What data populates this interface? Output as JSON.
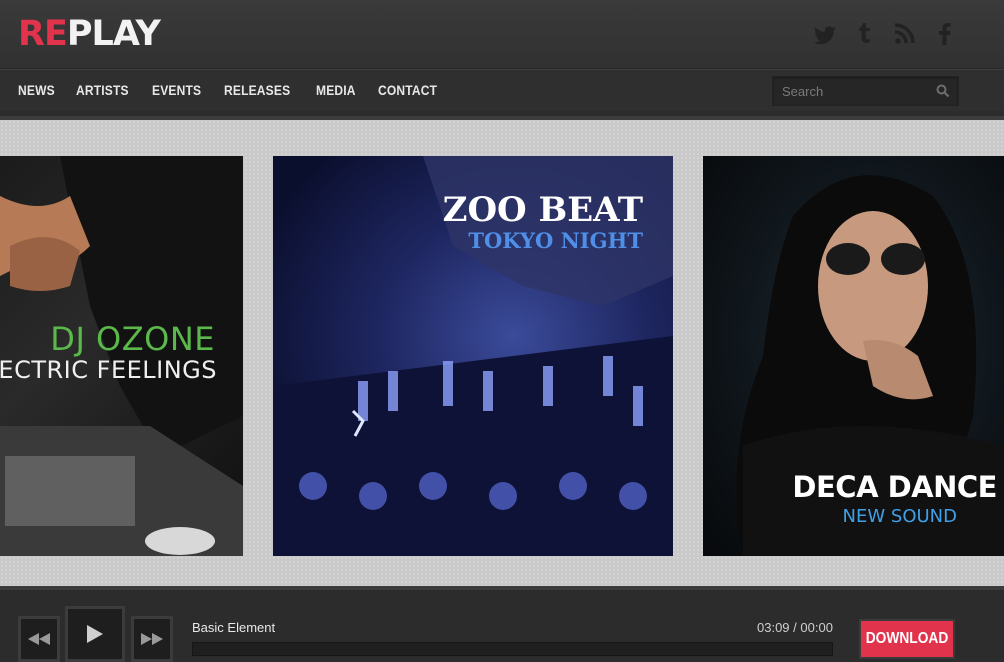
{
  "brand": {
    "logo_accent": "RE",
    "logo_rest": "PLAY",
    "accent_color": "#e1344c"
  },
  "social": [
    "twitter-icon",
    "tumblr-icon",
    "rss-icon",
    "facebook-icon"
  ],
  "nav": {
    "items": [
      "NEWS",
      "ARTISTS",
      "EVENTS",
      "RELEASES",
      "MEDIA",
      "CONTACT"
    ]
  },
  "search": {
    "placeholder": "Search",
    "value": ""
  },
  "slides": [
    {
      "title": "DJ OZONE",
      "subtitle": "ELECTRIC FEELINGS"
    },
    {
      "title": "ZOO BEAT",
      "subtitle": "TOKYO NIGHT"
    },
    {
      "title": "DECA DANCE",
      "subtitle": "NEW SOUND"
    }
  ],
  "player": {
    "track": "Basic Element",
    "time_current": "03:09",
    "time_separator": "/",
    "time_total": "00:00",
    "progress": 0,
    "download_label": "DOWNLOAD"
  }
}
